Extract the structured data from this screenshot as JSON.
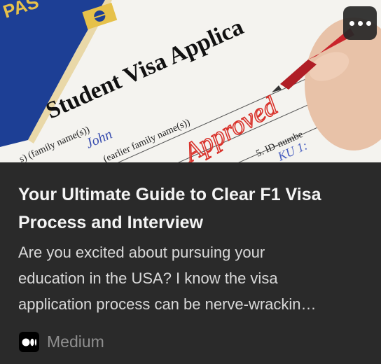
{
  "hero": {
    "heading_text": "Student Visa Applica",
    "stamp_text": "Approved",
    "passport_text": "PAS",
    "field_family_name": "s) (family name(s))",
    "field_earlier_name": "(earlier family name(s))",
    "field_id": "5. ID-numbe",
    "handwriting_name": "John",
    "handwriting_id": "KU 1:",
    "colors": {
      "passport": "#1a3a8f",
      "stamp": "#d9322b",
      "pen": "#c9242b"
    }
  },
  "more_button": {
    "icon": "more-horizontal-icon"
  },
  "article": {
    "title_lines": [
      "Your Ultimate Guide to Clear F1 Visa",
      "Process and Interview"
    ],
    "description_lines": [
      "Are you excited about pursuing your",
      "education in the USA? I know the visa",
      "application process can be nerve-wrackin…"
    ]
  },
  "source": {
    "name": "Medium",
    "icon": "medium-logo-icon"
  }
}
